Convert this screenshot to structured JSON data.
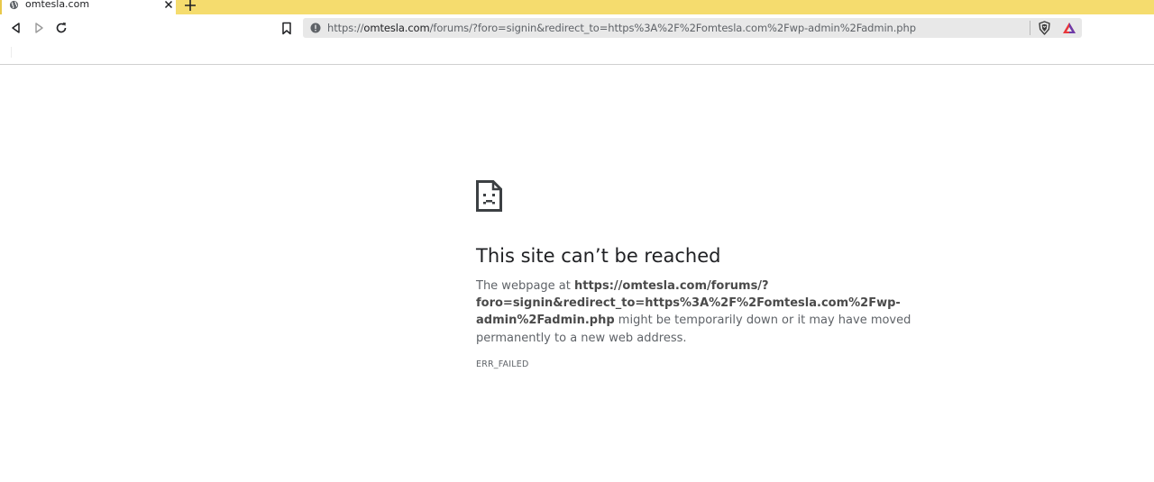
{
  "tab": {
    "title": "omtesla.com",
    "favicon": "globe-icon"
  },
  "toolbar": {
    "url_prefix": "https://",
    "url_host": "omtesla.com",
    "url_rest": "/forums/?foro=signin&redirect_to=https%3A%2F%2Fomtesla.com%2Fwp-admin%2Fadmin.php",
    "icons": [
      "back-icon",
      "forward-icon",
      "reload-icon",
      "bookmark-icon",
      "info-icon",
      "brave-shields-icon",
      "brave-rewards-icon"
    ]
  },
  "error": {
    "title": "This site can’t be reached",
    "desc_prefix": "The webpage at ",
    "url_line1": "https://omtesla.com/forums/?",
    "url_line2": "foro=signin&redirect_to=https%3A%2F%2Fomtesla.com%2Fwp-",
    "url_line3": "admin%2Fadmin.php",
    "desc_suffix": " might be temporarily down or it may have moved permanently to a new web address.",
    "code": "ERR_FAILED"
  },
  "colors": {
    "tabbar_bg": "#f5dc6e",
    "omnibox_bg": "#e8e8e8",
    "text_primary": "#202124",
    "text_secondary": "#5f6368"
  }
}
